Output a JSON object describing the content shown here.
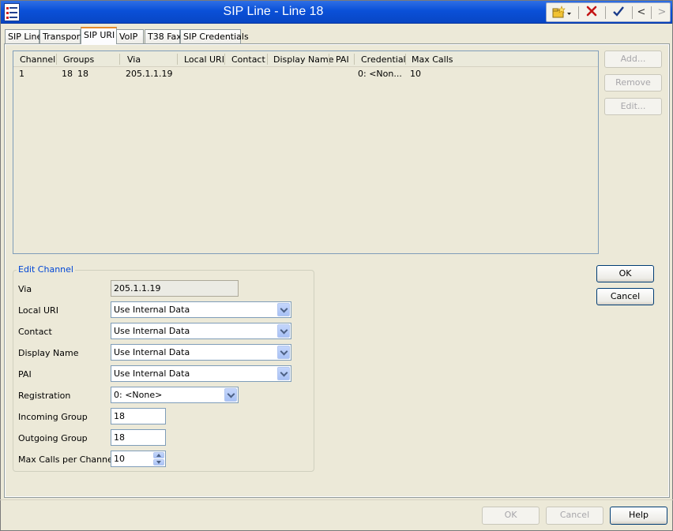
{
  "window": {
    "title": "SIP Line - Line 18"
  },
  "toolbar": {
    "new_icon": "new-folder-icon",
    "delete_icon": "red-x-icon",
    "apply_icon": "checkmark-icon",
    "prev_label": "<",
    "next_label": ">"
  },
  "tabs": [
    {
      "label": "SIP Line"
    },
    {
      "label": "Transport"
    },
    {
      "label": "SIP URI"
    },
    {
      "label": "VoIP"
    },
    {
      "label": "T38 Fax"
    },
    {
      "label": "SIP Credentials"
    }
  ],
  "active_tab": "SIP URI",
  "table": {
    "headers": [
      "Channel",
      "Groups",
      "Via",
      "Local URI",
      "Contact",
      "Display Name",
      "PAI",
      "Credential",
      "Max Calls"
    ],
    "rows": [
      {
        "channel": "1",
        "group_in": "18",
        "group_out": "18",
        "via": "205.1.1.19",
        "local_uri": "",
        "contact": "",
        "display_name": "",
        "pai": "",
        "credential": "0: <Non...",
        "max_calls": "10"
      }
    ]
  },
  "side_buttons": {
    "add": "Add...",
    "remove": "Remove",
    "edit": "Edit..."
  },
  "edit_channel": {
    "legend": "Edit Channel",
    "via_label": "Via",
    "via_value": "205.1.1.19",
    "local_uri_label": "Local URI",
    "local_uri_value": "Use Internal Data",
    "contact_label": "Contact",
    "contact_value": "Use Internal Data",
    "display_name_label": "Display Name",
    "display_name_value": "Use Internal Data",
    "pai_label": "PAI",
    "pai_value": "Use Internal Data",
    "registration_label": "Registration",
    "registration_value": "0: <None>",
    "incoming_group_label": "Incoming Group",
    "incoming_group_value": "18",
    "outgoing_group_label": "Outgoing Group",
    "outgoing_group_value": "18",
    "max_calls_label": "Max Calls per Channel",
    "max_calls_value": "10"
  },
  "edit_buttons": {
    "ok": "OK",
    "cancel": "Cancel"
  },
  "footer": {
    "ok": "OK",
    "cancel": "Cancel",
    "help": "Help"
  }
}
